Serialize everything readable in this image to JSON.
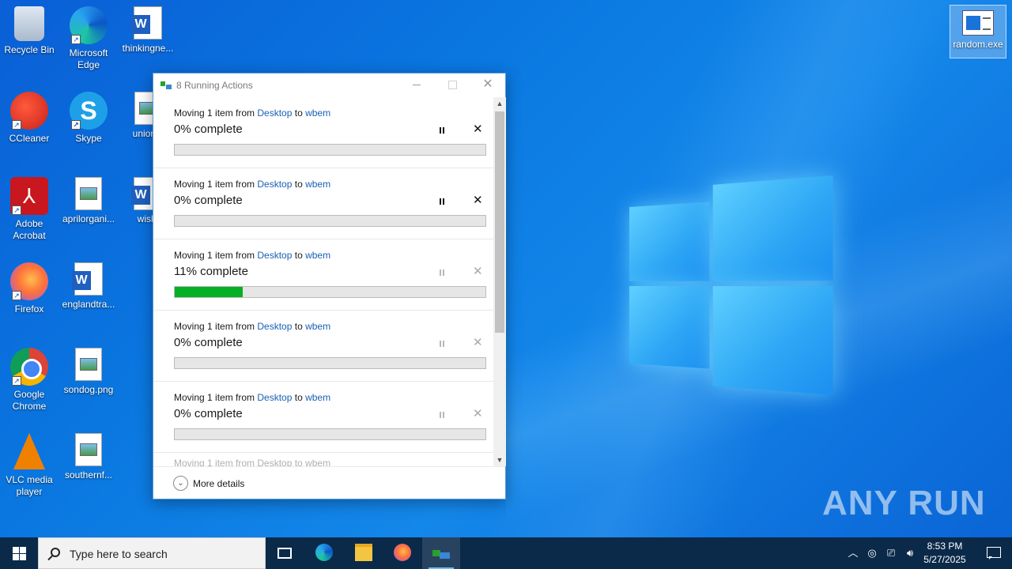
{
  "desktop": {
    "icons": [
      {
        "label": "Recycle Bin"
      },
      {
        "label": "Microsoft Edge"
      },
      {
        "label": "thinkingne..."
      },
      {
        "label": "CCleaner"
      },
      {
        "label": "Skype"
      },
      {
        "label": "unionst"
      },
      {
        "label": "Adobe Acrobat"
      },
      {
        "label": "aprilorgani..."
      },
      {
        "label": "wishi"
      },
      {
        "label": "Firefox"
      },
      {
        "label": "englandtra..."
      },
      {
        "label": "Google Chrome"
      },
      {
        "label": "sondog.png"
      },
      {
        "label": "VLC media player"
      },
      {
        "label": "southernf..."
      },
      {
        "label": "random.exe"
      }
    ],
    "watermark": "ANY RUN"
  },
  "dialog": {
    "title": "8 Running Actions",
    "operations": [
      {
        "prefix": "Moving 1 item from ",
        "source": "Desktop",
        "middle": " to ",
        "dest": "wbem",
        "percent_text": "0% complete",
        "progress": 0.0,
        "paused_enabled": true
      },
      {
        "prefix": "Moving 1 item from ",
        "source": "Desktop",
        "middle": " to ",
        "dest": "wbem",
        "percent_text": "0% complete",
        "progress": 0.0,
        "paused_enabled": true
      },
      {
        "prefix": "Moving 1 item from ",
        "source": "Desktop",
        "middle": " to ",
        "dest": "wbem",
        "percent_text": "11% complete",
        "progress": 0.22,
        "paused_enabled": false
      },
      {
        "prefix": "Moving 1 item from ",
        "source": "Desktop",
        "middle": " to ",
        "dest": "wbem",
        "percent_text": "0% complete",
        "progress": 0.0,
        "paused_enabled": false
      },
      {
        "prefix": "Moving 1 item from ",
        "source": "Desktop",
        "middle": " to ",
        "dest": "wbem",
        "percent_text": "0% complete",
        "progress": 0.0,
        "paused_enabled": false
      }
    ],
    "partial_operation": {
      "text": "Moving 1 item from Desktop to wbem"
    },
    "more_details": "More details",
    "progress_color": "#06b025"
  },
  "taskbar": {
    "search_placeholder": "Type here to search",
    "clock_time": "8:53 PM",
    "clock_date": "5/27/2025"
  }
}
